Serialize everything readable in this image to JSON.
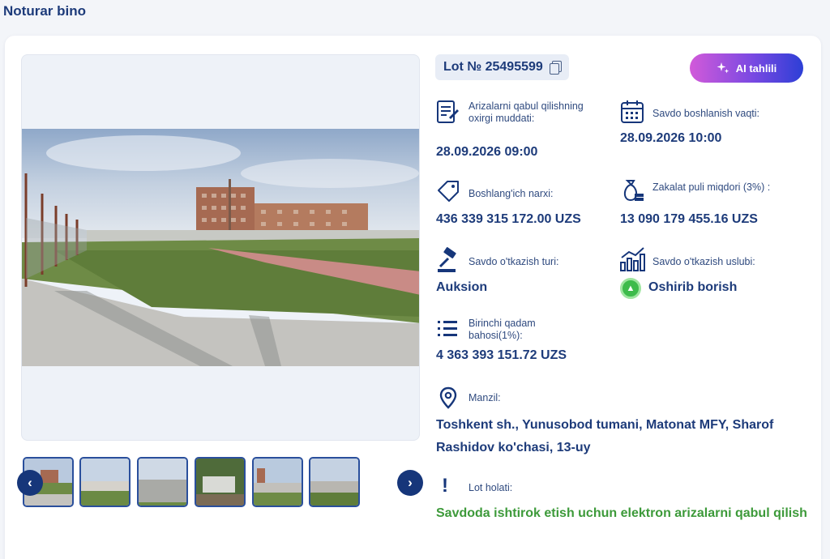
{
  "page": {
    "title": "Noturar bino"
  },
  "lot": {
    "label": "Lot № 25495599"
  },
  "ai_button": {
    "label": "AI tahlili"
  },
  "info": {
    "application_deadline": {
      "label": "Arizalarni qabul qilishning oxirgi muddati:",
      "value": "28.09.2026 09:00"
    },
    "auction_start": {
      "label": "Savdo boshlanish vaqti:",
      "value": "28.09.2026 10:00"
    },
    "starting_price": {
      "label": "Boshlang'ich narxi:",
      "value": "436 339 315 172.00 UZS"
    },
    "deposit": {
      "label": "Zakalat puli miqdori (3%) :",
      "value": "13 090 179 455.16 UZS"
    },
    "auction_type": {
      "label": "Savdo o'tkazish turi:",
      "value": "Auksion"
    },
    "auction_method": {
      "label": "Savdo o'tkazish uslubi:",
      "value": "Oshirib borish"
    },
    "first_step": {
      "label": "Birinchi qadam bahosi(1%):",
      "value": "4 363 393 151.72 UZS"
    },
    "address": {
      "label": "Manzil:",
      "value": "Toshkent sh., Yunusobod tumani, Matonat MFY, Sharof Rashidov ko'chasi, 13-uy"
    },
    "lot_status": {
      "label": "Lot holati:",
      "value": "Savdoda ishtirok etish uchun elektron arizalarni qabul qilish"
    }
  },
  "colors": {
    "primary": "#1d3b7a",
    "accent_green": "#3dbb4b",
    "status_green": "#3d9a3a",
    "ai_gradient_start": "#d25ad9",
    "ai_gradient_end": "#2d3fd6"
  },
  "icons": {
    "application_deadline": "document-form-icon",
    "auction_start": "calendar-icon",
    "starting_price": "price-tag-icon",
    "deposit": "money-bag-icon",
    "auction_type": "gavel-icon",
    "auction_method": "growth-chart-icon",
    "first_step": "list-icon",
    "address": "map-pin-icon",
    "lot_status": "exclamation-icon"
  },
  "gallery": {
    "thumbnail_count": 6
  }
}
